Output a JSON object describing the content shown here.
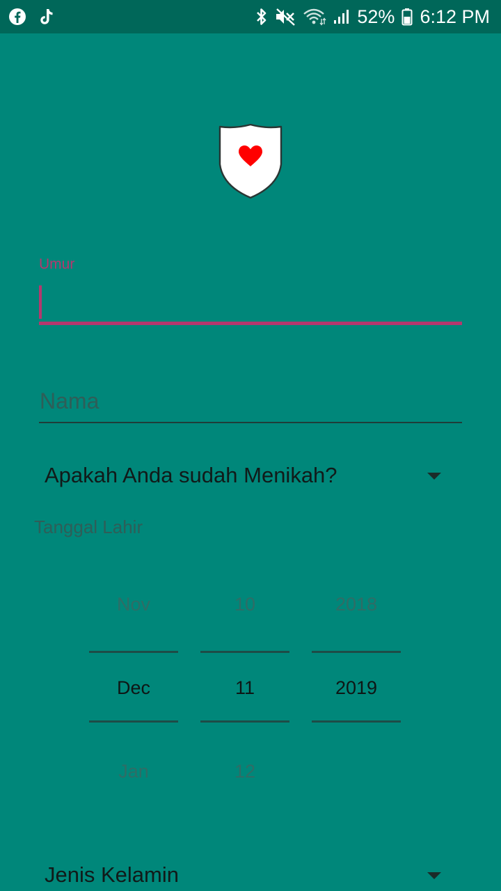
{
  "status_bar": {
    "battery": "52%",
    "time": "6:12 PM",
    "left_icons": [
      "facebook-icon",
      "tiktok-icon"
    ],
    "right_icons": [
      "bluetooth-icon",
      "mute-icon",
      "wifi-icon",
      "signal-icon",
      "battery-icon"
    ]
  },
  "logo": {
    "icon": "shield-heart-icon",
    "colors": {
      "shield": "#ffffff",
      "heart": "#ff0000"
    }
  },
  "form": {
    "umur_label": "Umur",
    "umur_value": "",
    "nama_placeholder": "Nama",
    "married_spinner": "Apakah Anda sudah Menikah?",
    "tanggal_label": "Tanggal Lahir",
    "gender_spinner": "Jenis Kelamin"
  },
  "date_picker": {
    "month": {
      "prev": "Nov",
      "current": "Dec",
      "next": "Jan"
    },
    "day": {
      "prev": "10",
      "current": "11",
      "next": "12"
    },
    "year": {
      "prev": "2018",
      "current": "2019",
      "next": ""
    }
  },
  "colors": {
    "background": "#00877A",
    "status_bar": "#006759",
    "accent": "#B4386E"
  }
}
